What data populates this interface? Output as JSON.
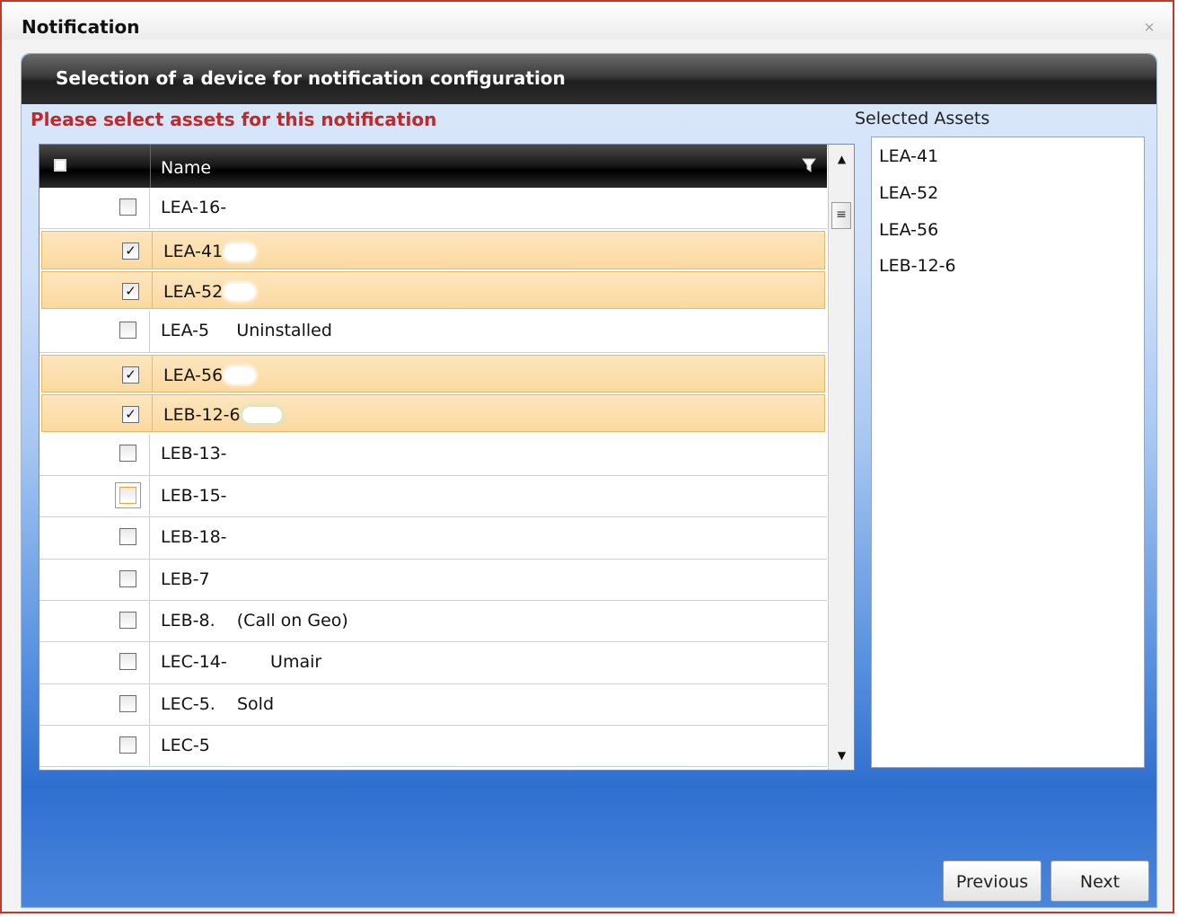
{
  "window": {
    "title": "Notification",
    "close_glyph": "⨯"
  },
  "panel": {
    "header": "Selection of a device for notification configuration",
    "prompt": "Please select assets for this notification",
    "selected_label": "Selected Assets"
  },
  "grid": {
    "column_name": "Name",
    "rows": [
      {
        "name": "LEA-16-",
        "checked": false
      },
      {
        "name": "LEA-41",
        "checked": true
      },
      {
        "name": "LEA-52",
        "checked": true
      },
      {
        "name": "LEA-5     Uninstalled",
        "checked": false
      },
      {
        "name": "LEA-56",
        "checked": true
      },
      {
        "name": "LEB-12-6",
        "checked": true
      },
      {
        "name": "LEB-13-",
        "checked": false
      },
      {
        "name": "LEB-15-",
        "checked": false,
        "focused": true
      },
      {
        "name": "LEB-18-",
        "checked": false
      },
      {
        "name": "LEB-7",
        "checked": false
      },
      {
        "name": "LEB-8.    (Call on Geo)",
        "checked": false
      },
      {
        "name": "LEC-14-        Umair",
        "checked": false
      },
      {
        "name": "LEC-5.    Sold",
        "checked": false
      },
      {
        "name": "LEC-5",
        "checked": false
      }
    ]
  },
  "selected_assets": [
    "LEA-41",
    "LEA-52",
    "LEA-56",
    "LEB-12-6"
  ],
  "buttons": {
    "previous": "Previous",
    "next": "Next"
  },
  "colors": {
    "title_border": "#c0392b",
    "prompt": "#c0282a",
    "selected_row": "#fbd9a0"
  }
}
